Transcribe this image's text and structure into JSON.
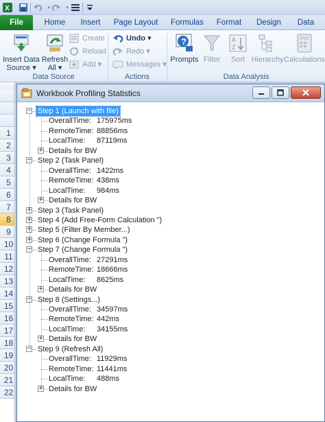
{
  "ribbon": {
    "tabs": [
      "File",
      "Home",
      "Insert",
      "Page Layout",
      "Formulas",
      "Format",
      "Design",
      "Data"
    ],
    "data_source": {
      "label": "Data Source",
      "insert_data_source": "Insert Data Source ▾",
      "refresh_all": "Refresh All ▾",
      "create": "Create",
      "reload": "Reload",
      "add": "Add ▾"
    },
    "actions": {
      "label": "Actions",
      "undo": "Undo ▾",
      "redo": "Redo ▾",
      "messages": "Messages ▾"
    },
    "data_analysis": {
      "label": "Data Analysis",
      "prompts": "Prompts",
      "filter": "Filter",
      "sort": "Sort",
      "hierarchy": "Hierarchy",
      "calculations": "Calculations"
    }
  },
  "sheet": {
    "rows": [
      "1",
      "2",
      "3",
      "4",
      "5",
      "6",
      "7",
      "8",
      "9",
      "10",
      "11",
      "12",
      "13",
      "14",
      "15",
      "16",
      "17",
      "18",
      "19",
      "20",
      "21",
      "22"
    ],
    "selected_row": "8"
  },
  "dialog": {
    "title": "Workbook Profiling Statistics",
    "steps": [
      {
        "label": "Step 1 (Launch with file)",
        "expanded": true,
        "selected": true,
        "metrics": [
          {
            "name": "OverallTime:",
            "value": "175975ms"
          },
          {
            "name": "RemoteTime:",
            "value": "88856ms"
          },
          {
            "name": "LocalTime:",
            "value": "87119ms"
          }
        ],
        "details": "Details for BW"
      },
      {
        "label": "Step 2 (Task Panel)",
        "expanded": true,
        "selected": false,
        "metrics": [
          {
            "name": "OverallTime:",
            "value": "1422ms"
          },
          {
            "name": "RemoteTime:",
            "value": "438ms"
          },
          {
            "name": "LocalTime:",
            "value": "984ms"
          }
        ],
        "details": "Details for BW"
      },
      {
        "label": "Step 3 (Task Panel)",
        "expanded": false,
        "selected": false,
        "metrics": [],
        "details": ""
      },
      {
        "label": "Step 4 (Add Free-Form Calculation \")",
        "expanded": false,
        "selected": false,
        "metrics": [],
        "details": ""
      },
      {
        "label": "Step 5 (Filter By Member...)",
        "expanded": false,
        "selected": false,
        "metrics": [],
        "details": ""
      },
      {
        "label": "Step 6 (Change Formula \")",
        "expanded": false,
        "selected": false,
        "metrics": [],
        "details": ""
      },
      {
        "label": "Step 7 (Change Formula \")",
        "expanded": true,
        "selected": false,
        "metrics": [
          {
            "name": "OverallTime:",
            "value": "27291ms"
          },
          {
            "name": "RemoteTime:",
            "value": "18666ms"
          },
          {
            "name": "LocalTime:",
            "value": "8625ms"
          }
        ],
        "details": "Details for BW"
      },
      {
        "label": "Step 8 (Settings...)",
        "expanded": true,
        "selected": false,
        "metrics": [
          {
            "name": "OverallTime:",
            "value": "34597ms"
          },
          {
            "name": "RemoteTime:",
            "value": "442ms"
          },
          {
            "name": "LocalTime:",
            "value": "34155ms"
          }
        ],
        "details": "Details for BW"
      },
      {
        "label": "Step 9 (Refresh All)",
        "expanded": true,
        "selected": false,
        "metrics": [
          {
            "name": "OverallTime:",
            "value": "11929ms"
          },
          {
            "name": "RemoteTime:",
            "value": "11441ms"
          },
          {
            "name": "LocalTime:",
            "value": "488ms"
          }
        ],
        "details": "Details for BW"
      }
    ]
  }
}
